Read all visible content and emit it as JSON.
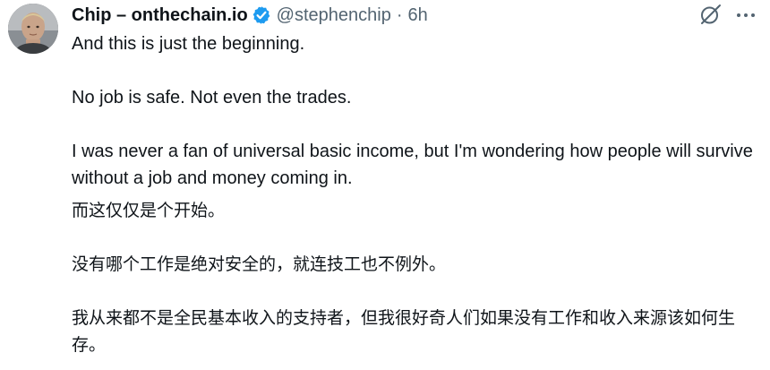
{
  "author": {
    "display_name": "Chip – onthechain.io",
    "handle": "@stephenchip",
    "separator": "·",
    "time": "6h",
    "avatar": "avatar-photo",
    "verified": true
  },
  "actions": {
    "grok_icon": "grok-icon",
    "more_icon": "more-icon"
  },
  "colors": {
    "text": "#0f1419",
    "secondary": "#536471",
    "verified": "#1d9bf0"
  },
  "tweet": {
    "en": {
      "p1": "And this is just the beginning.",
      "p2": "No job is safe. Not even the trades.",
      "p3": "I was never a fan of universal basic income, but I'm wondering how people will survive without a job and money coming in."
    },
    "zh": {
      "p1": "而这仅仅是个开始。",
      "p2": "没有哪个工作是绝对安全的，就连技工也不例外。",
      "p3": "我从来都不是全民基本收入的支持者，但我很好奇人们如果没有工作和收入来源该如何生存。"
    }
  }
}
